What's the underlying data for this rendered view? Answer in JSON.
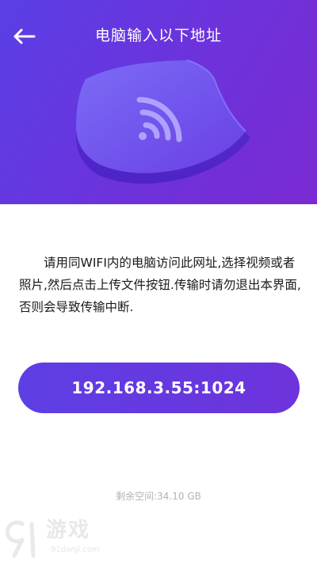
{
  "header": {
    "title": "电脑输入以下地址",
    "back_icon": "arrow-left-icon",
    "hero_icon": "wifi-shield-icon",
    "gradient_start": "#5a3fe6",
    "gradient_end": "#7a2ad2"
  },
  "main": {
    "instructions": "请用同WIFI内的电脑访问此网址,选择视频或者照片,然后点击上传文件按钮.传输时请勿退出本界面,否则会导致传输中断.",
    "address": "192.168.3.55:1024",
    "storage": "剩余空间:34.10 GB"
  },
  "watermark": {
    "logo_digits": "91",
    "name": "游戏",
    "url": "91danji.com"
  }
}
